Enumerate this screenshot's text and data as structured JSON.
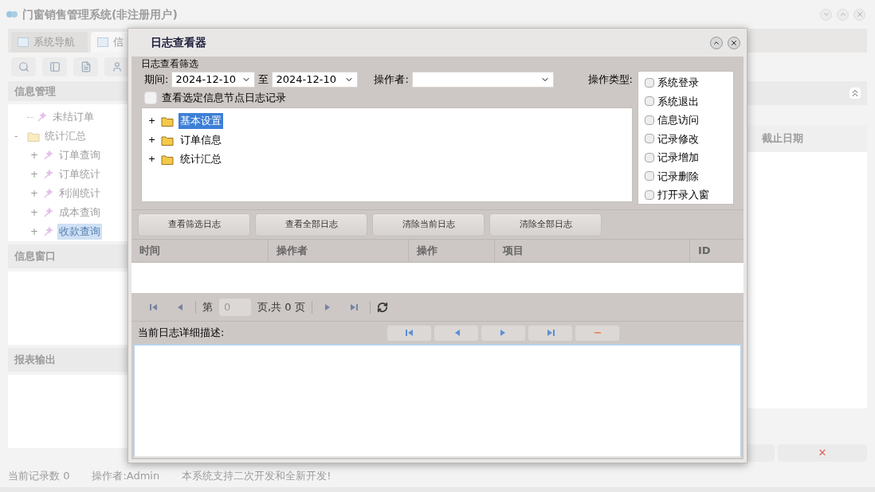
{
  "app": {
    "title": "门窗销售管理系统(非注册用户)",
    "tabs": [
      {
        "label": "系统导航",
        "selected": false
      },
      {
        "label": "信",
        "selected": true
      }
    ],
    "sidebar": {
      "sections": [
        {
          "title": "信息管理",
          "tree": [
            {
              "label": "未结订单",
              "kind": "leaf",
              "selected": false
            },
            {
              "label": "统计汇总",
              "kind": "folder",
              "expander": "-",
              "selected": false,
              "children": [
                {
                  "label": "订单查询",
                  "kind": "branch",
                  "expander": "+",
                  "selected": false
                },
                {
                  "label": "订单统计",
                  "kind": "branch",
                  "expander": "+",
                  "selected": false
                },
                {
                  "label": "利润统计",
                  "kind": "branch",
                  "expander": "+",
                  "selected": false
                },
                {
                  "label": "成本查询",
                  "kind": "branch",
                  "expander": "+",
                  "selected": false
                },
                {
                  "label": "收款查询",
                  "kind": "branch",
                  "expander": "+",
                  "selected": true
                }
              ]
            }
          ]
        },
        {
          "title": "信息窗口"
        },
        {
          "title": "报表输出"
        }
      ]
    },
    "grid": {
      "columns": [
        "截止日期"
      ]
    },
    "delete_button": "✕",
    "status_bar": [
      "当前记录数 0",
      "操作者:Admin",
      "本系统支持二次开发和全新开发!"
    ]
  },
  "dialog": {
    "title": "日志查看器",
    "filter": {
      "group_label": "日志查看筛选",
      "period_label": "期间:",
      "date_from": "2024-12-10",
      "to_label": "至",
      "date_to": "2024-12-10",
      "operator_label": "操作者:",
      "op_type_label": "操作类型:",
      "op_types": [
        {
          "label": "系统登录",
          "checked": false
        },
        {
          "label": "系统退出",
          "checked": false
        },
        {
          "label": "信息访问",
          "checked": false
        },
        {
          "label": "记录修改",
          "checked": false
        },
        {
          "label": "记录增加",
          "checked": false
        },
        {
          "label": "记录删除",
          "checked": false
        },
        {
          "label": "打开录入窗",
          "checked": false
        }
      ],
      "node_filter": {
        "label": "查看选定信息节点日志记录",
        "checked": false
      }
    },
    "tree": [
      {
        "label": "基本设置",
        "expander": "+",
        "selected": true
      },
      {
        "label": "订单信息",
        "expander": "+",
        "selected": false
      },
      {
        "label": "统计汇总",
        "expander": "+",
        "selected": false
      }
    ],
    "buttons": [
      "查看筛选日志",
      "查看全部日志",
      "清除当前日志",
      "清除全部日志"
    ],
    "table": {
      "columns": [
        "时间",
        "操作者",
        "操作",
        "项目",
        "ID"
      ]
    },
    "pager": {
      "page_label": "第",
      "page": "0",
      "total": "页,共 0 页"
    },
    "detail_label": "当前日志详细描述:"
  }
}
